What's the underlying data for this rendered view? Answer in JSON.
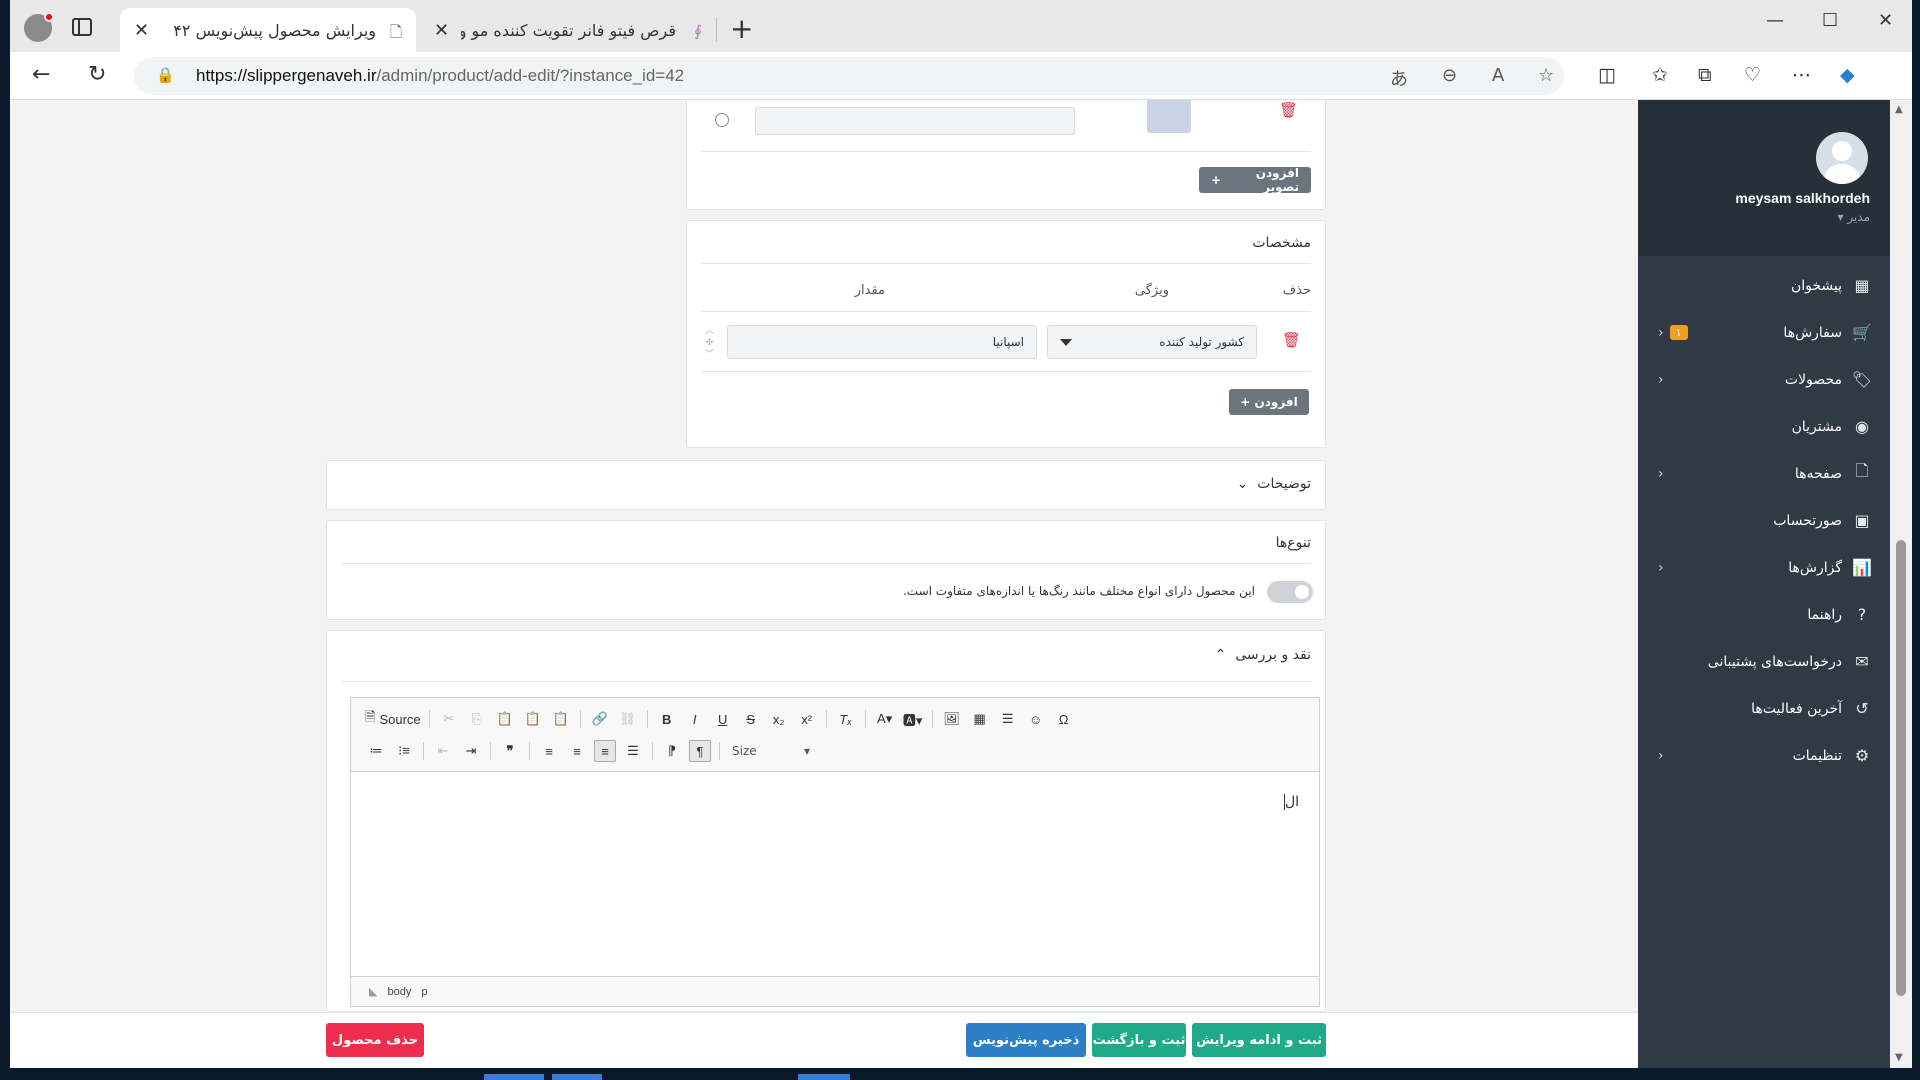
{
  "browser": {
    "tabs": [
      {
        "title": "ویرایش محصول پیش‌نویس ۴۲",
        "active": true
      },
      {
        "title": "قرص فیتو فانر تقویت کننده مو و نا",
        "active": false
      }
    ],
    "url_host": "https://slippergenaveh.ir",
    "url_path": "/admin/product/add-edit/?instance_id=42"
  },
  "sidebar": {
    "user_name": "meysam salkhordeh",
    "user_role": "مدیر",
    "items": [
      {
        "label": "پیشخوان",
        "icon": "dashboard-icon",
        "has_children": false
      },
      {
        "label": "سفارش‌ها",
        "icon": "cart-icon",
        "has_children": true,
        "badge": "۱"
      },
      {
        "label": "محصولات",
        "icon": "tag-icon",
        "has_children": true
      },
      {
        "label": "مشتریان",
        "icon": "user-circle-icon",
        "has_children": false
      },
      {
        "label": "صفحه‌ها",
        "icon": "file-icon",
        "has_children": true
      },
      {
        "label": "صورتحساب",
        "icon": "money-icon",
        "has_children": false
      },
      {
        "label": "گزارش‌ها",
        "icon": "chart-icon",
        "has_children": true
      },
      {
        "label": "راهنما",
        "icon": "help-icon",
        "has_children": false
      },
      {
        "label": "درخواست‌های پشتیبانی",
        "icon": "envelope-icon",
        "has_children": false
      },
      {
        "label": "آخرین فعالیت‌ها",
        "icon": "history-icon",
        "has_children": false
      },
      {
        "label": "تنظیمات",
        "icon": "cogs-icon",
        "has_children": true
      }
    ]
  },
  "images": {
    "add_image_label": "افزودن تصویر"
  },
  "specs": {
    "title": "مشخصات",
    "col_delete": "حذف",
    "col_attribute": "ویژگی",
    "col_value": "مقدار",
    "rows": [
      {
        "attribute": "کشور تولید کننده",
        "value": "اسپانیا"
      }
    ],
    "add_label": "افزودن"
  },
  "description": {
    "title": "توضیحات"
  },
  "variations": {
    "title": "تنوع‌ها",
    "toggle_text": "این محصول دارای انواع مختلف مانند رنگ‌ها یا اندازه‌های متفاوت است."
  },
  "review": {
    "title": "نقد و بررسی",
    "source_label": "Source",
    "size_label": "Size",
    "content": "ال",
    "path": [
      "body",
      "p"
    ]
  },
  "footer": {
    "save_continue": "ثبت و ادامه ویرایش",
    "save_back": "ثبت و بازگشت",
    "save_draft": "ذخیره پیش‌نویس",
    "delete_product": "حذف محصول"
  },
  "colors": {
    "sidebar_bg": "#2f3a44",
    "green": "#1fab89",
    "blue": "#2c7fc5",
    "red": "#ef2d4f",
    "gray_button": "#6c757d"
  }
}
